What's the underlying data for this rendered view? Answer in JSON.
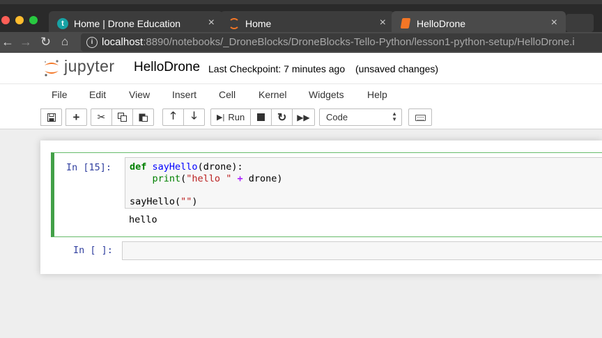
{
  "browser": {
    "tabs": [
      {
        "label": "Home | Drone Education",
        "favicon": "t"
      },
      {
        "label": "Home"
      },
      {
        "label": "HelloDrone"
      }
    ],
    "close_glyph": "×",
    "url_host": "localhost",
    "url_rest": ":8890/notebooks/_DroneBlocks/DroneBlocks-Tello-Python/lesson1-python-setup/HelloDrone.i",
    "info_glyph": "i"
  },
  "header": {
    "logo_text": "jupyter",
    "notebook_name": "HelloDrone",
    "checkpoint": "Last Checkpoint: 7 minutes ago",
    "status": "(unsaved changes)"
  },
  "menu": [
    "File",
    "Edit",
    "View",
    "Insert",
    "Cell",
    "Kernel",
    "Widgets",
    "Help"
  ],
  "toolbar": {
    "run_label": "Run",
    "cell_type": "Code"
  },
  "cells": {
    "cell1": {
      "prompt": "In [15]:",
      "output": "hello"
    },
    "cell2": {
      "prompt": "In [ ]:"
    }
  },
  "colors": {
    "jupyter_orange": "#f37626",
    "selected_cell": "#42a047",
    "prompt_in": "#303f9f"
  }
}
